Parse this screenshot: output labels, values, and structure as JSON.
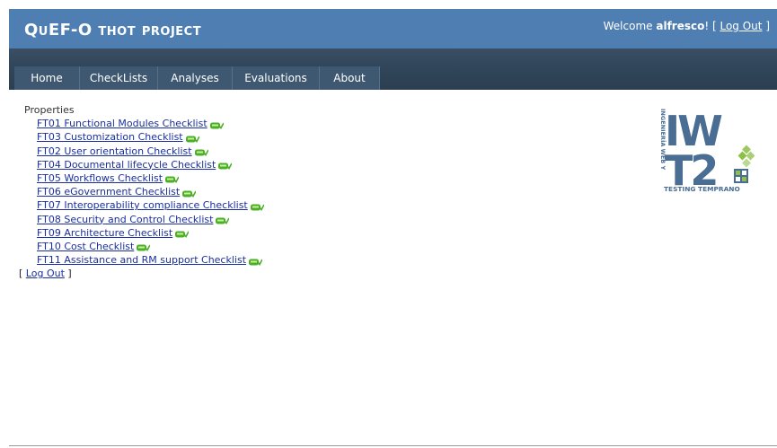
{
  "header": {
    "title": "QuEF-O thot project",
    "welcome_prefix": "Welcome ",
    "username": "alfresco",
    "welcome_suffix": "! [ ",
    "logout_label": "Log Out",
    "close_bracket": " ]"
  },
  "menu": {
    "items": [
      {
        "label": "Home"
      },
      {
        "label": "CheckLists"
      },
      {
        "label": "Analyses"
      },
      {
        "label": "Evaluations"
      },
      {
        "label": "About"
      }
    ]
  },
  "main": {
    "heading": "Properties",
    "checklists": [
      {
        "label": "FT01 Functional Modules Checklist"
      },
      {
        "label": "FT03 Customization Checklist"
      },
      {
        "label": "FT02 User orientation Checklist"
      },
      {
        "label": "FT04 Documental lifecycle Checklist"
      },
      {
        "label": "FT05 Workflows Checklist"
      },
      {
        "label": "FT06 eGovernment Checklist"
      },
      {
        "label": "FT07 Interoperability compliance Checklist"
      },
      {
        "label": "FT08 Security and Control Checklist"
      },
      {
        "label": "FT09 Architecture Checklist"
      },
      {
        "label": "FT10 Cost Checklist"
      },
      {
        "label": "FT11 Assistance and RM support Checklist"
      }
    ],
    "logout": {
      "open": "[ ",
      "label": "Log Out",
      "close": " ]"
    },
    "status_icon": "ok-status-icon"
  },
  "logo": {
    "side_text": "INGENIERÍA WEB Y",
    "big_text_1": "IW",
    "big_text_2": "T2",
    "bottom_text": "TESTING TEMPRANO"
  },
  "colors": {
    "header_bg": "#4f7fb2",
    "navbar_bg": "#31465a",
    "tab_bg": "#3e5871",
    "link": "#1a2f9e",
    "icon_green": "#4caf28",
    "logo_blue": "#4a6d93",
    "logo_green": "#8cc047"
  }
}
